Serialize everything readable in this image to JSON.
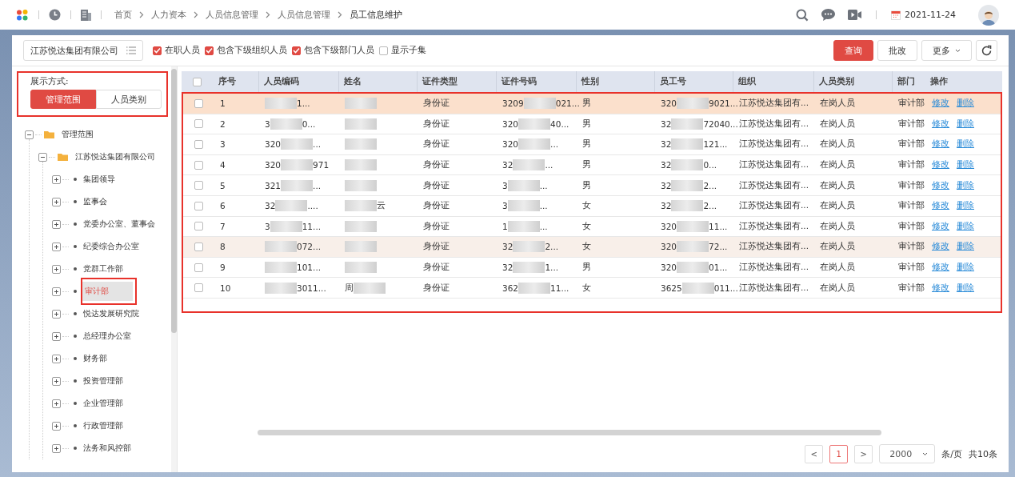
{
  "header": {
    "breadcrumbs": [
      "首页",
      "人力资本",
      "人员信息管理",
      "人员信息管理",
      "员工信息维护"
    ],
    "date": "2021-11-24"
  },
  "org_selector": {
    "value": "江苏悦达集团有限公司"
  },
  "filters": [
    {
      "label": "在职人员",
      "checked": true
    },
    {
      "label": "包含下级组织人员",
      "checked": true
    },
    {
      "label": "包含下级部门人员",
      "checked": true
    },
    {
      "label": "显示子集",
      "checked": false
    }
  ],
  "actions": [
    {
      "kind": "primary",
      "label": "查询"
    },
    {
      "kind": "default",
      "label": "批改"
    },
    {
      "kind": "dropdown",
      "label": "更多"
    },
    {
      "kind": "refresh"
    }
  ],
  "display_mode": {
    "label": "展示方式:",
    "highlighted": true,
    "options": [
      {
        "label": "管理范围",
        "selected": true
      },
      {
        "label": "人员类别",
        "selected": false
      }
    ]
  },
  "tree": [
    {
      "label": "管理范围",
      "kind": "folder",
      "expanded": true,
      "selected": false,
      "children": [
        {
          "label": "江苏悦达集团有限公司",
          "kind": "folder",
          "expanded": true,
          "selected": false,
          "children": [
            {
              "label": "集团领导",
              "kind": "leaf",
              "expanded": false,
              "selected": false
            },
            {
              "label": "监事会",
              "kind": "leaf",
              "expanded": false,
              "selected": false
            },
            {
              "label": "党委办公室、董事会",
              "kind": "leaf",
              "expanded": false,
              "selected": false
            },
            {
              "label": "纪委综合办公室",
              "kind": "leaf",
              "expanded": false,
              "selected": false
            },
            {
              "label": "党群工作部",
              "kind": "leaf",
              "expanded": false,
              "selected": false
            },
            {
              "label": "审计部",
              "kind": "leaf",
              "expanded": false,
              "selected": true,
              "highlighted": true
            },
            {
              "label": "悦达发展研究院",
              "kind": "leaf",
              "expanded": false,
              "selected": false
            },
            {
              "label": "总经理办公室",
              "kind": "leaf",
              "expanded": false,
              "selected": false
            },
            {
              "label": "财务部",
              "kind": "leaf",
              "expanded": false,
              "selected": false
            },
            {
              "label": "投资管理部",
              "kind": "leaf",
              "expanded": false,
              "selected": false
            },
            {
              "label": "企业管理部",
              "kind": "leaf",
              "expanded": false,
              "selected": false
            },
            {
              "label": "行政管理部",
              "kind": "leaf",
              "expanded": false,
              "selected": false
            },
            {
              "label": "法务和风控部",
              "kind": "leaf",
              "expanded": false,
              "selected": false
            }
          ]
        }
      ]
    }
  ],
  "table": {
    "highlighted": true,
    "select_all": {
      "checked": false
    },
    "columns": [
      "序号",
      "人员编码",
      "姓名",
      "证件类型",
      "证件号码",
      "性别",
      "员工号",
      "组织",
      "人员类别",
      "部门",
      "操作"
    ],
    "rows": [
      {
        "selected": true,
        "hovered": false,
        "checked": false,
        "no": "1",
        "code": {
          "tail": "1..."
        },
        "name": {},
        "id_type": "身份证",
        "id_no": {
          "head": "3209",
          "tail": "021..."
        },
        "gender": "男",
        "emp_no": {
          "head": "320",
          "tail": "9021..."
        },
        "org": "江苏悦达集团有...",
        "category": "在岗人员",
        "dept": "审计部",
        "actions": [
          "修改",
          "删除"
        ]
      },
      {
        "selected": false,
        "hovered": false,
        "checked": false,
        "no": "2",
        "code": {
          "head": "3",
          "tail": "0..."
        },
        "name": {},
        "id_type": "身份证",
        "id_no": {
          "head": "320",
          "tail": "40..."
        },
        "gender": "男",
        "emp_no": {
          "head": "32",
          "tail": "72040..."
        },
        "org": "江苏悦达集团有...",
        "category": "在岗人员",
        "dept": "审计部",
        "actions": [
          "修改",
          "删除"
        ]
      },
      {
        "selected": false,
        "hovered": false,
        "checked": false,
        "no": "3",
        "code": {
          "head": "320",
          "tail": "..."
        },
        "name": {},
        "id_type": "身份证",
        "id_no": {
          "head": "320",
          "tail": "..."
        },
        "gender": "男",
        "emp_no": {
          "head": "32",
          "tail": "121..."
        },
        "org": "江苏悦达集团有...",
        "category": "在岗人员",
        "dept": "审计部",
        "actions": [
          "修改",
          "删除"
        ]
      },
      {
        "selected": false,
        "hovered": false,
        "checked": false,
        "no": "4",
        "code": {
          "head": "320",
          "tail": "971"
        },
        "name": {},
        "id_type": "身份证",
        "id_no": {
          "head": "32",
          "tail": "..."
        },
        "gender": "男",
        "emp_no": {
          "head": "32",
          "tail": "0..."
        },
        "org": "江苏悦达集团有...",
        "category": "在岗人员",
        "dept": "审计部",
        "actions": [
          "修改",
          "删除"
        ]
      },
      {
        "selected": false,
        "hovered": false,
        "checked": false,
        "no": "5",
        "code": {
          "head": "321",
          "tail": "..."
        },
        "name": {},
        "id_type": "身份证",
        "id_no": {
          "head": "3",
          "tail": "..."
        },
        "gender": "男",
        "emp_no": {
          "head": "32",
          "tail": "2..."
        },
        "org": "江苏悦达集团有...",
        "category": "在岗人员",
        "dept": "审计部",
        "actions": [
          "修改",
          "删除"
        ]
      },
      {
        "selected": false,
        "hovered": false,
        "checked": false,
        "no": "6",
        "code": {
          "head": "32",
          "tail": "...."
        },
        "name": {
          "tail": "云"
        },
        "id_type": "身份证",
        "id_no": {
          "head": "3",
          "tail": "..."
        },
        "gender": "女",
        "emp_no": {
          "head": "32",
          "tail": "2..."
        },
        "org": "江苏悦达集团有...",
        "category": "在岗人员",
        "dept": "审计部",
        "actions": [
          "修改",
          "删除"
        ]
      },
      {
        "selected": false,
        "hovered": false,
        "checked": false,
        "no": "7",
        "code": {
          "head": "3",
          "tail": "11..."
        },
        "name": {},
        "id_type": "身份证",
        "id_no": {
          "head": "1",
          "tail": "..."
        },
        "gender": "女",
        "emp_no": {
          "head": "320",
          "tail": "11..."
        },
        "org": "江苏悦达集团有...",
        "category": "在岗人员",
        "dept": "审计部",
        "actions": [
          "修改",
          "删除"
        ]
      },
      {
        "selected": false,
        "hovered": true,
        "checked": false,
        "no": "8",
        "code": {
          "tail": "072..."
        },
        "name": {},
        "id_type": "身份证",
        "id_no": {
          "head": "32",
          "tail": "2..."
        },
        "gender": "女",
        "emp_no": {
          "head": "320",
          "tail": "72..."
        },
        "org": "江苏悦达集团有...",
        "category": "在岗人员",
        "dept": "审计部",
        "actions": [
          "修改",
          "删除"
        ]
      },
      {
        "selected": false,
        "hovered": false,
        "checked": false,
        "no": "9",
        "code": {
          "tail": "101..."
        },
        "name": {},
        "id_type": "身份证",
        "id_no": {
          "head": "32",
          "tail": "1..."
        },
        "gender": "男",
        "emp_no": {
          "head": "320",
          "tail": "01..."
        },
        "org": "江苏悦达集团有...",
        "category": "在岗人员",
        "dept": "审计部",
        "actions": [
          "修改",
          "删除"
        ]
      },
      {
        "selected": false,
        "hovered": false,
        "checked": false,
        "no": "10",
        "code": {
          "tail": "3011..."
        },
        "name": {
          "head": "周"
        },
        "id_type": "身份证",
        "id_no": {
          "head": "362",
          "tail": "11..."
        },
        "gender": "女",
        "emp_no": {
          "head": "3625",
          "tail": "011..."
        },
        "org": "江苏悦达集团有...",
        "category": "在岗人员",
        "dept": "审计部",
        "actions": [
          "修改",
          "删除"
        ]
      }
    ]
  },
  "pagination": {
    "prev": "<",
    "next": ">",
    "pages": [
      {
        "label": "1",
        "selected": true
      }
    ],
    "page_size": "2000",
    "unit": "条/页",
    "total": "共10条"
  }
}
